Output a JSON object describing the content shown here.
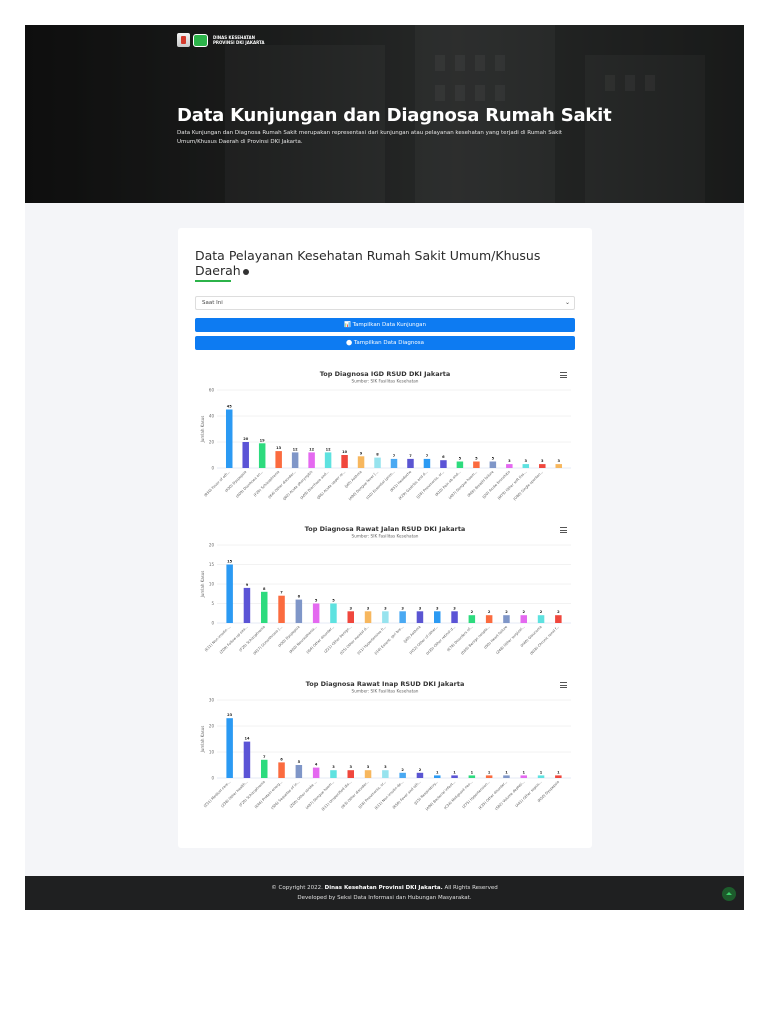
{
  "brand": {
    "line1": "DINAS KESEHATAN",
    "line2": "PROVINSI DKI JAKARTA"
  },
  "hero": {
    "title": "Data Kunjungan dan Diagnosa Rumah Sakit",
    "description": "Data Kunjungan dan Diagnosa Rumah Sakit merupakan representasi dari kunjungan atau pelayanan kesehatan yang terjadi di Rumah Sakit Umum/Khusus Daerah di Provinsi DKI Jakarta."
  },
  "card": {
    "title": "Data Pelayanan Kesehatan Rumah Sakit Umum/Khusus Daerah",
    "select_value": "Saat Ini",
    "btn_kunjungan": "📊 Tampilkan Data Kunjungan",
    "btn_diagnosa": "⬤ Tampilkan Data Diagnosa"
  },
  "colors": [
    "#2b9af3",
    "#5b54d6",
    "#2ddb7e",
    "#fb6b3f",
    "#7f96c8",
    "#e469f0",
    "#5ee2e0",
    "#f0473d",
    "#f7b75e",
    "#97e3ee",
    "#4aa9f2",
    "#5a55d2"
  ],
  "chart_data": [
    {
      "type": "bar",
      "title": "Top Diagnosa IGD RSUD DKI Jakarta",
      "subtitle": "Sumber: SIK Fasilitas Kesehatan",
      "ylabel": "Jumlah Kasus",
      "ylim": [
        0,
        60
      ],
      "yticks": [
        0,
        20,
        40,
        60
      ],
      "categories": [
        "(R50) Fever of oth...",
        "(K30) Dyspepsia",
        "(A09) Diarrhoea an...",
        "(F20) Schizophrenia",
        "(I64) Other disorder...",
        "(J02) Acute pharyngitis",
        "(A09) Diarrhoea and...",
        "(J06) Acute upper re...",
        "(J45) Asthma",
        "(A90) Dengue fever [...",
        "(I10) Essential (prim...",
        "(R51) Headache",
        "(K29) Gastritis and d...",
        "(J18) Pneumonia, or...",
        "(R10) Pain ab and...",
        "(A97) Dengue haem...",
        "(R06) Breathl failure",
        "(J20) Acute bronchitis",
        "(M79) Other soft tiss...",
        "(O80) Single spontan..."
      ],
      "values": [
        45,
        20,
        19,
        13,
        12,
        12,
        12,
        10,
        9,
        8,
        7,
        7,
        7,
        6,
        5,
        5,
        5,
        3,
        3,
        3,
        3
      ]
    },
    {
      "type": "bar",
      "title": "Top Diagnosa Rawat Jalan RSUD DKI Jakarta",
      "subtitle": "Sumber: SIK Fasilitas Kesehatan",
      "ylabel": "Jumlah Kasus",
      "ylim": [
        0,
        20
      ],
      "yticks": [
        0,
        5,
        10,
        15,
        20
      ],
      "categories": [
        "(E11) Non-insulin-...",
        "(Z09) Follow-up exa...",
        "(F20) Schizophrenia",
        "(M17) Gonarthrosis [...",
        "(K30) Dyspepsia",
        "(R50) Neurasthenia...",
        "(I64) Other disorder...",
        "(Z21) Other benign...",
        "(I25) Other mental d...",
        "(I11) Hypertensive h...",
        "(I10) Essent. (pri bre...",
        "(J45) Asthma",
        "(H52) Other of other...",
        "(H35) Other retinal d...",
        "(E78) Disorders of...",
        "(D59) Benign neopla...",
        "(I50) Heart failure",
        "(Z48) Other surgical...",
        "(H40) Glaucoma",
        "(N18) Chronic renal f..."
      ],
      "values": [
        15,
        9,
        8,
        7,
        6,
        5,
        5,
        3,
        3,
        3,
        3,
        3,
        3,
        3,
        2,
        2,
        2,
        2,
        2,
        2
      ]
    },
    {
      "type": "bar",
      "title": "Top Diagnosa Rawat Inap RSUD DKI Jakarta",
      "subtitle": "Sumber: SIK Fasilitas Kesehatan",
      "ylabel": "Jumlah Kasus",
      "ylim": [
        0,
        30
      ],
      "yticks": [
        0,
        10,
        20,
        30
      ],
      "categories": [
        "(Z51) Medical care...",
        "(Z38) Other health...",
        "(F20) Schizophrenia",
        "(E46) Protein-energ...",
        "(S06) Sequelae of in...",
        "(Z00) Other stroke ...",
        "(A97) Dengue haem...",
        "(E11) Unspecified dia...",
        "(I63) Other disorder...",
        "(J18) Pneumonia, or...",
        "(E11) Non-insulin-de...",
        "(R50) Fever and oth...",
        "(J15) Respiratory...",
        "(A90) Bacterial infect...",
        "(C34) Malignant neo...",
        "(Z75) Hypertension...",
        "(K35) Other disorder...",
        "(S82) Volume depleti...",
        "(A41) Other sepsis...",
        "(R50) Dyspepsia"
      ],
      "values": [
        23,
        14,
        7,
        6,
        5,
        4,
        3,
        3,
        3,
        3,
        2,
        2,
        1,
        1,
        1,
        1,
        1,
        1,
        1,
        1
      ]
    }
  ],
  "footer": {
    "copyright_prefix": "© Copyright 2022.",
    "org": "Dinas Kesehatan Provinsi DKI Jakarta.",
    "rights": "All Rights Reserved",
    "developed": "Developed by Seksi Data Informasi dan Hubungan Masyarakat."
  }
}
